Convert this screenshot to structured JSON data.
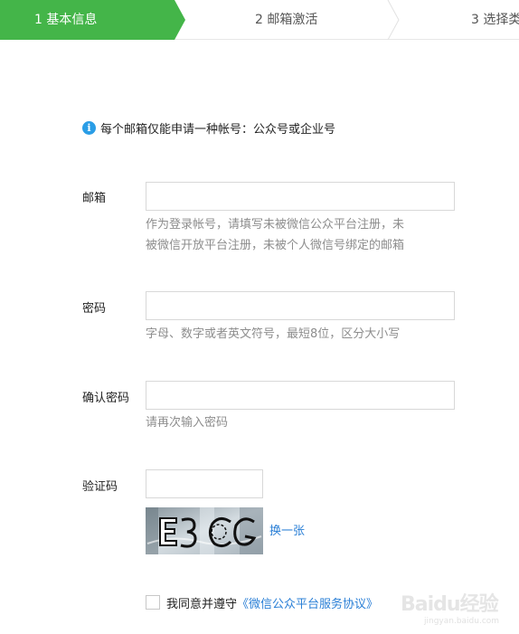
{
  "steps": [
    {
      "label": "1 基本信息",
      "active": true
    },
    {
      "label": "2 邮箱激活",
      "active": false
    },
    {
      "label": "3 选择类",
      "active": false
    }
  ],
  "notice": {
    "icon": "info-icon",
    "text": "每个邮箱仅能申请一种帐号：公众号或企业号"
  },
  "form": {
    "email": {
      "label": "邮箱",
      "value": "",
      "placeholder": "",
      "hint_line1": "作为登录帐号，请填写未被微信公众平台注册，未",
      "hint_line2": "被微信开放平台注册，未被个人微信号绑定的邮箱"
    },
    "password": {
      "label": "密码",
      "value": "",
      "placeholder": "",
      "hint": "字母、数字或者英文符号，最短8位，区分大小写"
    },
    "confirm_password": {
      "label": "确认密码",
      "value": "",
      "placeholder": "",
      "hint": "请再次输入密码"
    },
    "captcha": {
      "label": "验证码",
      "value": "",
      "placeholder": "",
      "image_text": "E3CG",
      "refresh_label": "换一张"
    }
  },
  "agreement": {
    "checked": false,
    "text": "我同意并遵守",
    "link_text": "《微信公众平台服务协议》"
  },
  "watermark": {
    "brand": "Baidu经验",
    "url": "jingyan.baidu.com"
  },
  "colors": {
    "accent": "#44b549",
    "link": "#2a7fd6",
    "info": "#2a9de6",
    "hint": "#8d8d8d"
  }
}
